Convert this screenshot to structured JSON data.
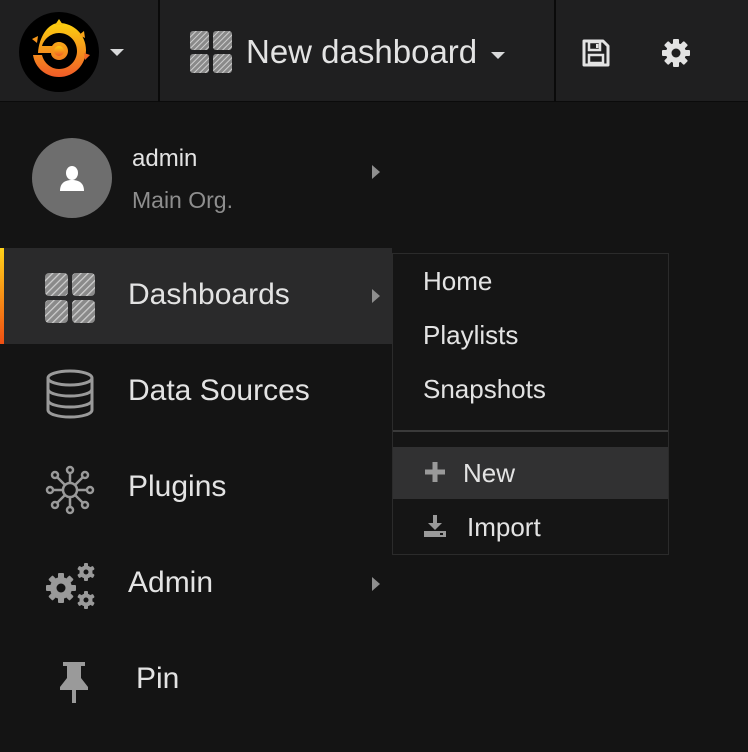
{
  "navbar": {
    "logo_icon": "grafana-logo-icon",
    "dashboard_title": "New dashboard",
    "save_icon": "save-icon",
    "settings_icon": "gear-icon"
  },
  "user": {
    "name": "admin",
    "org": "Main Org."
  },
  "menu": {
    "items": [
      {
        "label": "Dashboards",
        "icon": "dashboards-grid-icon",
        "active": true,
        "has_submenu": true
      },
      {
        "label": "Data Sources",
        "icon": "database-icon",
        "active": false,
        "has_submenu": false
      },
      {
        "label": "Plugins",
        "icon": "plugins-icon",
        "active": false,
        "has_submenu": false
      },
      {
        "label": "Admin",
        "icon": "admin-gears-icon",
        "active": false,
        "has_submenu": true
      },
      {
        "label": "Pin",
        "icon": "pin-icon",
        "active": false,
        "has_submenu": false
      }
    ]
  },
  "submenu": {
    "items": [
      {
        "label": "Home"
      },
      {
        "label": "Playlists"
      },
      {
        "label": "Snapshots"
      }
    ],
    "actions": [
      {
        "label": "New",
        "icon": "plus-icon"
      },
      {
        "label": "Import",
        "icon": "import-icon"
      }
    ]
  },
  "colors": {
    "accent_top": "#ffd119",
    "accent_bottom": "#ef4f13",
    "background": "#141414",
    "navbar": "#1f1f20"
  }
}
